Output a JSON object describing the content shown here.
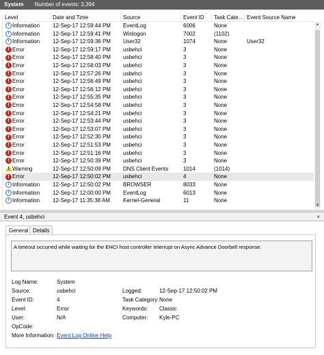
{
  "header": {
    "log_name": "System",
    "event_count": "Number of events: 3,394"
  },
  "grid": {
    "columns": [
      "Level",
      "Date and Time",
      "Source",
      "Event ID",
      "Task Cate...",
      "Event Source Name"
    ],
    "rows": [
      {
        "level": "Information",
        "icon": "info-icon",
        "datetime": "12-Sep-17 12:59:44 PM",
        "source": "EventLog",
        "event_id": "6006",
        "task": "None",
        "esn": ""
      },
      {
        "level": "Information",
        "icon": "info-icon",
        "datetime": "12-Sep-17 12:59:41 PM",
        "source": "Winlogon",
        "event_id": "7002",
        "task": "(1102)",
        "esn": ""
      },
      {
        "level": "Information",
        "icon": "info-icon",
        "datetime": "12-Sep-17 12:59:36 PM",
        "source": "User32",
        "event_id": "1074",
        "task": "None",
        "esn": "User32"
      },
      {
        "level": "Error",
        "icon": "error-icon",
        "datetime": "12-Sep-17 12:59:17 PM",
        "source": "usbehci",
        "event_id": "3",
        "task": "None",
        "esn": ""
      },
      {
        "level": "Error",
        "icon": "error-icon",
        "datetime": "12-Sep-17 12:58:40 PM",
        "source": "usbehci",
        "event_id": "3",
        "task": "None",
        "esn": ""
      },
      {
        "level": "Error",
        "icon": "error-icon",
        "datetime": "12-Sep-17 12:58:03 PM",
        "source": "usbehci",
        "event_id": "3",
        "task": "None",
        "esn": ""
      },
      {
        "level": "Error",
        "icon": "error-icon",
        "datetime": "12-Sep-17 12:57:26 PM",
        "source": "usbehci",
        "event_id": "3",
        "task": "None",
        "esn": ""
      },
      {
        "level": "Error",
        "icon": "error-icon",
        "datetime": "12-Sep-17 12:56:49 PM",
        "source": "usbehci",
        "event_id": "3",
        "task": "None",
        "esn": ""
      },
      {
        "level": "Error",
        "icon": "error-icon",
        "datetime": "12-Sep-17 12:56:12 PM",
        "source": "usbehci",
        "event_id": "3",
        "task": "None",
        "esn": ""
      },
      {
        "level": "Error",
        "icon": "error-icon",
        "datetime": "12-Sep-17 12:55:35 PM",
        "source": "usbehci",
        "event_id": "3",
        "task": "None",
        "esn": ""
      },
      {
        "level": "Error",
        "icon": "error-icon",
        "datetime": "12-Sep-17 12:54:58 PM",
        "source": "usbehci",
        "event_id": "3",
        "task": "None",
        "esn": ""
      },
      {
        "level": "Error",
        "icon": "error-icon",
        "datetime": "12-Sep-17 12:54:21 PM",
        "source": "usbehci",
        "event_id": "3",
        "task": "None",
        "esn": ""
      },
      {
        "level": "Error",
        "icon": "error-icon",
        "datetime": "12-Sep-17 12:53:44 PM",
        "source": "usbehci",
        "event_id": "3",
        "task": "None",
        "esn": ""
      },
      {
        "level": "Error",
        "icon": "error-icon",
        "datetime": "12-Sep-17 12:53:07 PM",
        "source": "usbehci",
        "event_id": "3",
        "task": "None",
        "esn": ""
      },
      {
        "level": "Error",
        "icon": "error-icon",
        "datetime": "12-Sep-17 12:52:30 PM",
        "source": "usbehci",
        "event_id": "3",
        "task": "None",
        "esn": ""
      },
      {
        "level": "Error",
        "icon": "error-icon",
        "datetime": "12-Sep-17 12:51:53 PM",
        "source": "usbehci",
        "event_id": "3",
        "task": "None",
        "esn": ""
      },
      {
        "level": "Error",
        "icon": "error-icon",
        "datetime": "12-Sep-17 12:51:16 PM",
        "source": "usbehci",
        "event_id": "3",
        "task": "None",
        "esn": ""
      },
      {
        "level": "Error",
        "icon": "error-icon",
        "datetime": "12-Sep-17 12:50:39 PM",
        "source": "usbehci",
        "event_id": "3",
        "task": "None",
        "esn": ""
      },
      {
        "level": "Warning",
        "icon": "warning-icon",
        "datetime": "12-Sep-17 12:50:09 PM",
        "source": "DNS Client Events",
        "event_id": "1014",
        "task": "(1014)",
        "esn": ""
      },
      {
        "level": "Error",
        "icon": "error-icon",
        "datetime": "12-Sep-17 12:50:02 PM",
        "source": "usbehci",
        "event_id": "4",
        "task": "None",
        "esn": "",
        "selected": true
      },
      {
        "level": "Information",
        "icon": "info-icon",
        "datetime": "12-Sep-17 12:50:02 PM",
        "source": "BROWSER",
        "event_id": "8033",
        "task": "None",
        "esn": ""
      },
      {
        "level": "Information",
        "icon": "info-icon",
        "datetime": "12-Sep-17 12:00:00 PM",
        "source": "EventLog",
        "event_id": "6013",
        "task": "None",
        "esn": ""
      },
      {
        "level": "Information",
        "icon": "info-icon",
        "datetime": "12-Sep-17 11:35:38 AM",
        "source": "Kernel-General",
        "event_id": "11",
        "task": "None",
        "esn": ""
      }
    ]
  },
  "detail": {
    "title": "Event 4, usbehci",
    "close_glyph": "×",
    "tabs": [
      {
        "label": "General"
      },
      {
        "label": "Details"
      }
    ],
    "description": "A timeout occurred while waiting for the EHCI host controller Interrupt on Async Advance Doorbell response.",
    "props": {
      "log_name_label": "Log Name:",
      "log_name": "System",
      "source_label": "Source:",
      "source": "usbehci",
      "logged_label": "Logged:",
      "logged": "12-Sep-17 12:50:02 PM",
      "event_id_label": "Event ID:",
      "event_id": "4",
      "task_label": "Task Category:",
      "task": "None",
      "level_label": "Level:",
      "level": "Error",
      "keywords_label": "Keywords:",
      "keywords": "Classic",
      "user_label": "User:",
      "user": "N/A",
      "computer_label": "Computer:",
      "computer": "Kyle-PC",
      "opcode_label": "OpCode:",
      "opcode": "",
      "more_info_label": "More Information:",
      "more_info_link": "Event Log Online Help"
    }
  },
  "colors": {
    "header_bg": "#5d5d5d",
    "error_red": "#c42b1c",
    "info_blue": "#3567b4",
    "warning_yellow": "#f0c000",
    "link_blue": "#0645ad",
    "selected_row": "#e8e8e8"
  }
}
